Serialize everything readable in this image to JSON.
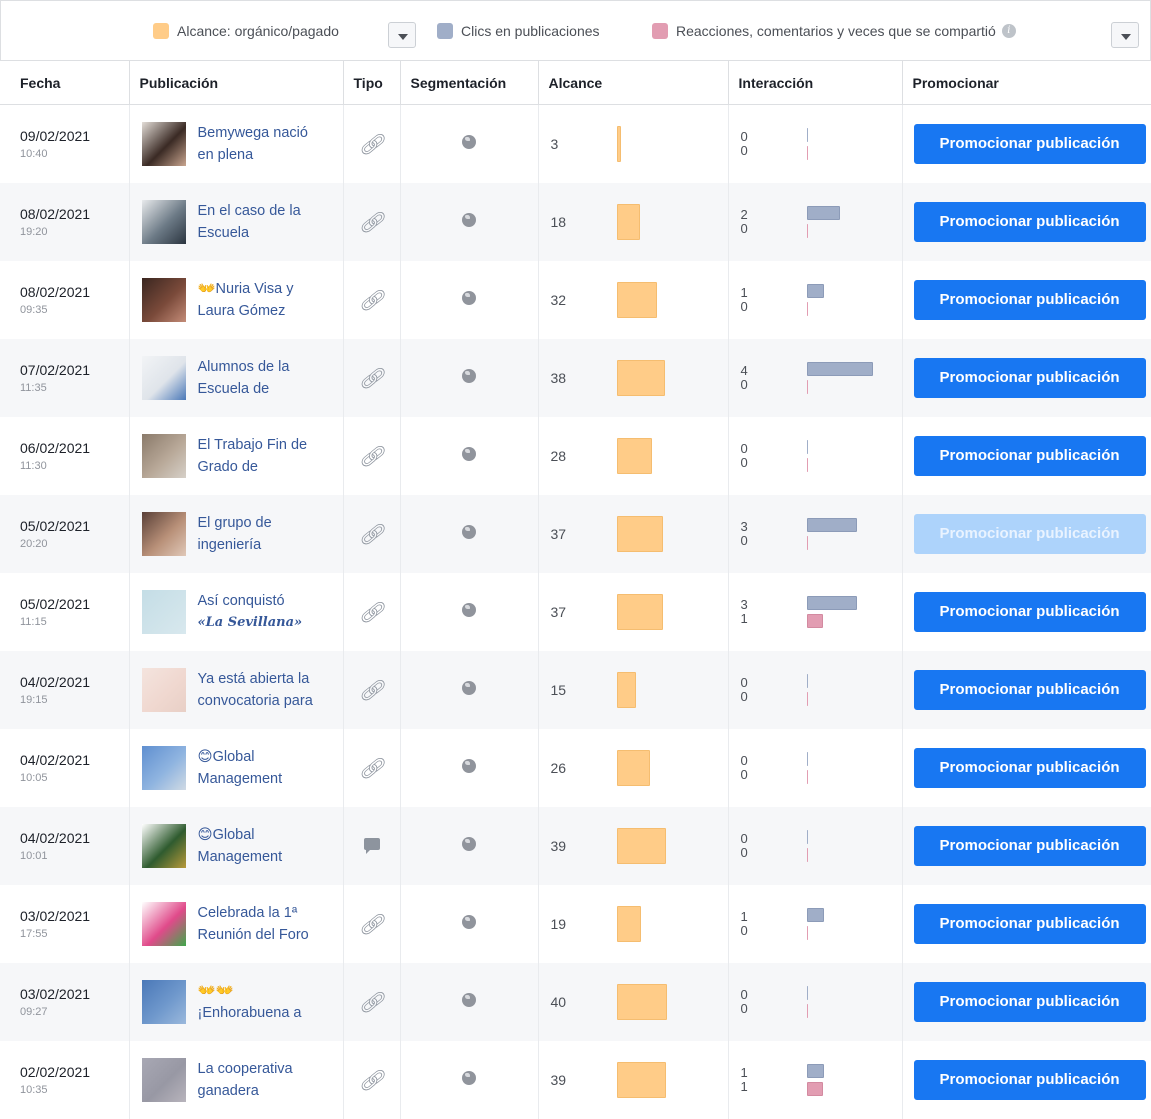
{
  "legend": {
    "reach_label": "Alcance: orgánico/pagado",
    "clicks_label": "Clics en publicaciones",
    "reactions_label": "Reacciones, comentarios y veces que se compartió",
    "colors": {
      "reach": "#ffcc88",
      "clicks": "#a0aec8",
      "reactions": "#e29db2"
    }
  },
  "table": {
    "headers": {
      "date": "Fecha",
      "post": "Publicación",
      "type": "Tipo",
      "targeting": "Segmentación",
      "reach": "Alcance",
      "engagement": "Interacción",
      "promote": "Promocionar"
    },
    "rows": [
      {
        "date": "09/02/2021",
        "time": "10:40",
        "title1": "Bemywega nació",
        "title2": "en plena",
        "type": "link-icon",
        "reach": 3,
        "clicks": 0,
        "reactions": 0,
        "button": "Promocionar publicación",
        "button_enabled": true,
        "thumb": [
          "#e3ddd7",
          "#3a2a24",
          "#c9a58f"
        ]
      },
      {
        "date": "08/02/2021",
        "time": "19:20",
        "title1": "En el caso de la",
        "title2": "Escuela",
        "type": "link-icon",
        "reach": 18,
        "clicks": 2,
        "reactions": 0,
        "button": "Promocionar publicación",
        "button_enabled": true,
        "thumb": [
          "#e8eaec",
          "#6c7a86",
          "#2b3540"
        ]
      },
      {
        "date": "08/02/2021",
        "time": "09:35",
        "title1": "👐Nuria Visa y",
        "title2": "Laura Gómez",
        "type": "link-icon",
        "reach": 32,
        "clicks": 1,
        "reactions": 0,
        "button": "Promocionar publicación",
        "button_enabled": true,
        "thumb": [
          "#3a2620",
          "#7a4a3a",
          "#c48c78"
        ]
      },
      {
        "date": "07/02/2021",
        "time": "11:35",
        "title1": "Alumnos de la",
        "title2": "Escuela de",
        "type": "link-icon",
        "reach": 38,
        "clicks": 4,
        "reactions": 0,
        "button": "Promocionar publicación",
        "button_enabled": true,
        "thumb": [
          "#f2f4f6",
          "#dfe4ea",
          "#4a78b8"
        ]
      },
      {
        "date": "06/02/2021",
        "time": "11:30",
        "title1": "El Trabajo Fin de",
        "title2": "Grado de",
        "type": "link-icon",
        "reach": 28,
        "clicks": 0,
        "reactions": 0,
        "button": "Promocionar publicación",
        "button_enabled": true,
        "thumb": [
          "#8a7a6a",
          "#b8a898",
          "#d6d0c8"
        ]
      },
      {
        "date": "05/02/2021",
        "time": "20:20",
        "title1": "El grupo de",
        "title2": "ingeniería",
        "type": "link-icon",
        "reach": 37,
        "clicks": 3,
        "reactions": 0,
        "button": "Promocionar publicación",
        "button_enabled": false,
        "thumb": [
          "#5a4038",
          "#b89078",
          "#e0c8b8"
        ]
      },
      {
        "date": "05/02/2021",
        "time": "11:15",
        "title1": "Así conquistó",
        "title2": "«La Sevillana»",
        "type": "link-icon",
        "reach": 37,
        "clicks": 3,
        "reactions": 1,
        "button": "Promocionar publicación",
        "button_enabled": true,
        "thumb": [
          "#c4dde6",
          "#cfe3ea",
          "#d8e8ee"
        ]
      },
      {
        "date": "04/02/2021",
        "time": "19:15",
        "title1": "Ya está abierta la",
        "title2": "convocatoria para",
        "type": "link-icon",
        "reach": 15,
        "clicks": 0,
        "reactions": 0,
        "button": "Promocionar publicación",
        "button_enabled": true,
        "thumb": [
          "#f4e4de",
          "#f0d8d0",
          "#e8cfc6"
        ]
      },
      {
        "date": "04/02/2021",
        "time": "10:05",
        "title1": "😊Global",
        "title2": "Management",
        "type": "link-icon",
        "reach": 26,
        "clicks": 0,
        "reactions": 0,
        "button": "Promocionar publicación",
        "button_enabled": true,
        "thumb": [
          "#5f8fd0",
          "#8fb4e0",
          "#d0dae4"
        ]
      },
      {
        "date": "04/02/2021",
        "time": "10:01",
        "title1": "😊Global",
        "title2": "Management",
        "type": "status-icon",
        "reach": 39,
        "clicks": 0,
        "reactions": 0,
        "button": "Promocionar publicación",
        "button_enabled": true,
        "thumb": [
          "#ffffff",
          "#2f5b2f",
          "#b89a3a"
        ]
      },
      {
        "date": "03/02/2021",
        "time": "17:55",
        "title1": "Celebrada la 1ª",
        "title2": "Reunión del Foro",
        "type": "link-icon",
        "reach": 19,
        "clicks": 1,
        "reactions": 0,
        "button": "Promocionar publicación",
        "button_enabled": true,
        "thumb": [
          "#ffffff",
          "#e04a8a",
          "#3fa84a"
        ]
      },
      {
        "date": "03/02/2021",
        "time": "09:27",
        "title1": "👐👐",
        "title2": "¡Enhorabuena a",
        "type": "link-icon",
        "reach": 40,
        "clicks": 0,
        "reactions": 0,
        "button": "Promocionar publicación",
        "button_enabled": true,
        "thumb": [
          "#4a78b8",
          "#6f98cc",
          "#9ab8dc"
        ]
      },
      {
        "date": "02/02/2021",
        "time": "10:35",
        "title1": "La cooperativa",
        "title2": "ganadera",
        "type": "link-icon",
        "reach": 39,
        "clicks": 1,
        "reactions": 1,
        "button": "Promocionar publicación",
        "button_enabled": true,
        "thumb": [
          "#a8a8b4",
          "#9898a4",
          "#b8b4bc"
        ]
      }
    ]
  }
}
